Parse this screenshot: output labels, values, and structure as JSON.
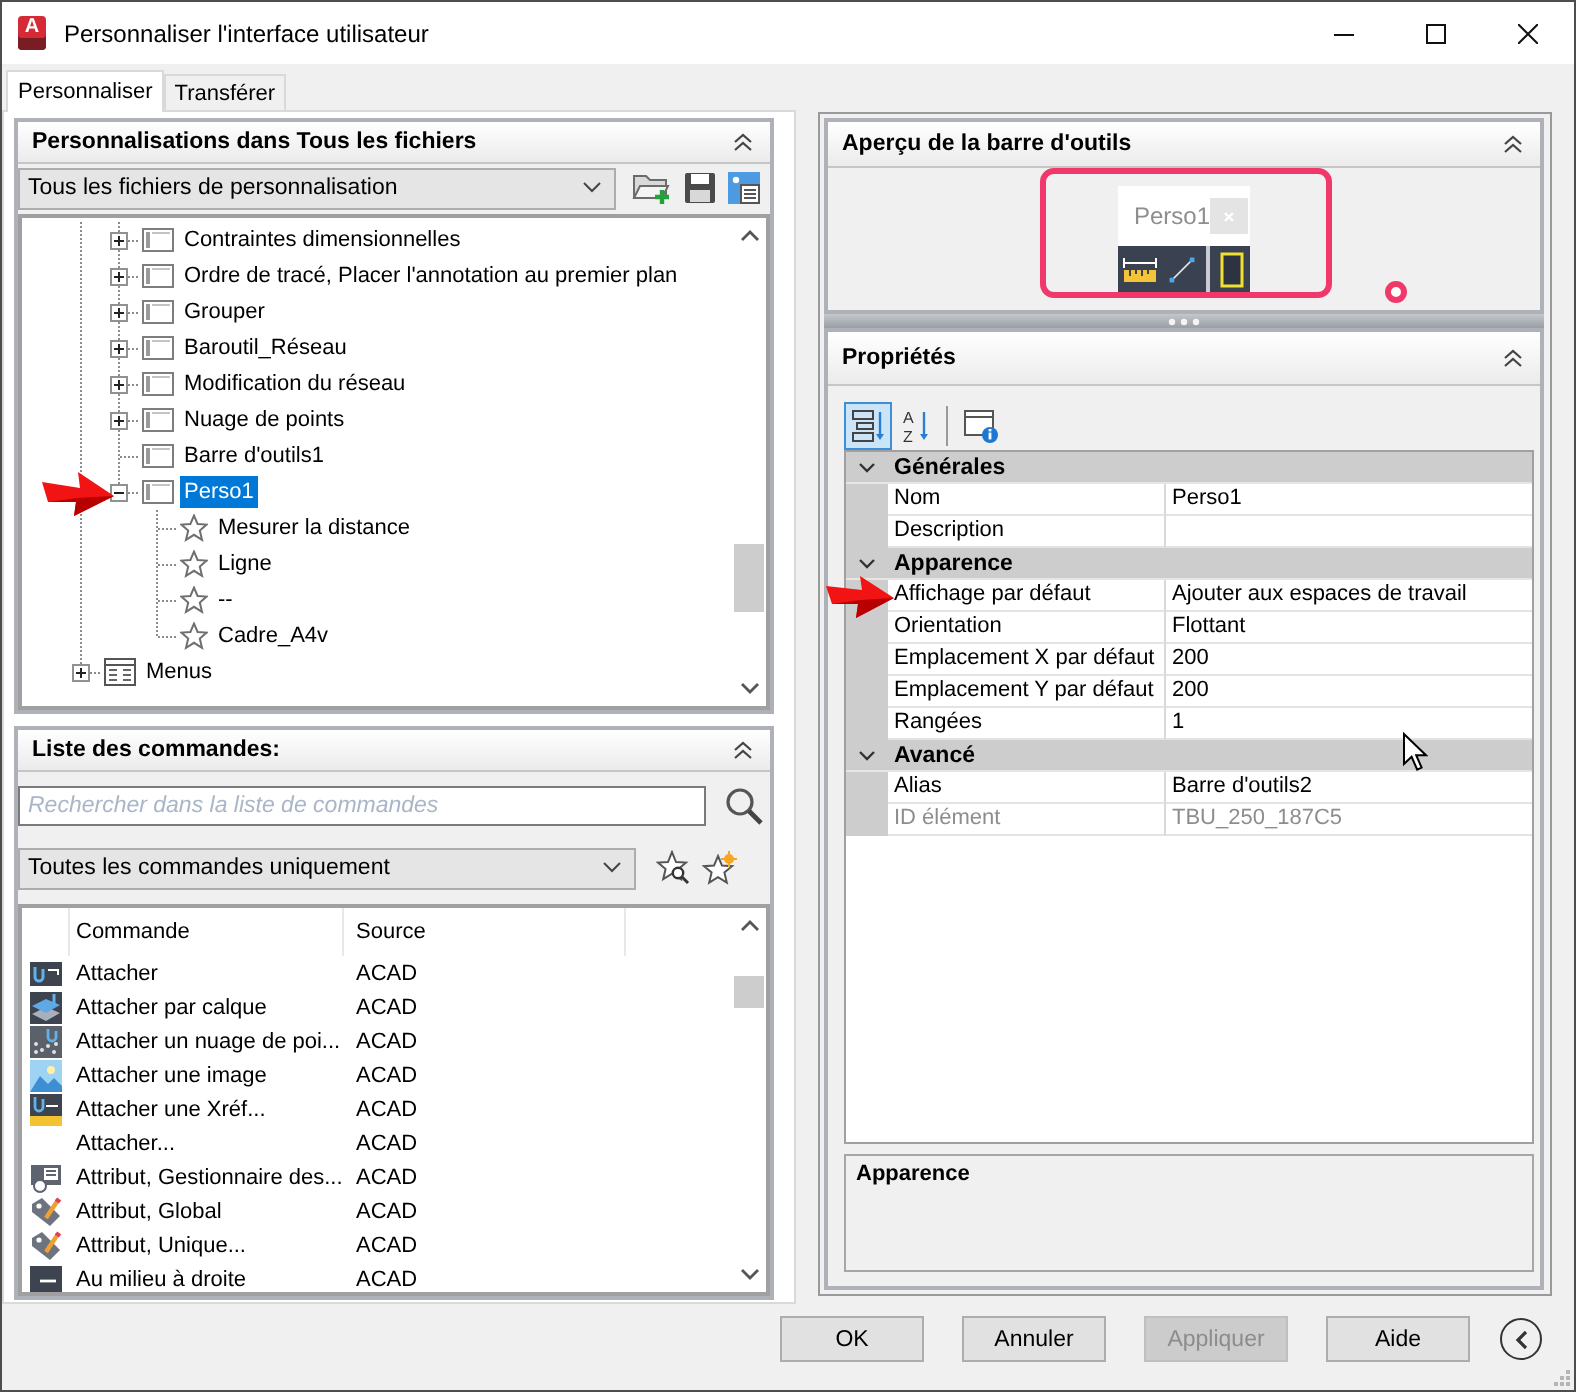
{
  "window": {
    "logo_letter": "A",
    "title": "Personnaliser l'interface utilisateur"
  },
  "tabs": [
    {
      "label": "Personnaliser",
      "selected": true
    },
    {
      "label": "Transférer",
      "selected": false
    }
  ],
  "customizations": {
    "title": "Personnalisations dans Tous les fichiers",
    "expanded": true,
    "file_filter": "Tous les fichiers de personnalisation",
    "tree": [
      {
        "children": [
          {
            "kind": "toolbar",
            "label": "Contraintes dimensionnelles",
            "expanded": false,
            "selected": false
          },
          {
            "kind": "toolbar",
            "label": "Ordre de tracé, Placer l'annotation au premier plan",
            "expanded": false,
            "selected": false
          },
          {
            "kind": "toolbar",
            "label": "Grouper",
            "expanded": false,
            "selected": false
          },
          {
            "kind": "toolbar",
            "label": "Baroutil_Réseau",
            "expanded": false,
            "selected": false
          },
          {
            "kind": "toolbar",
            "label": "Modification du réseau",
            "expanded": false,
            "selected": false
          },
          {
            "kind": "toolbar",
            "label": "Nuage de points",
            "expanded": false,
            "selected": false
          },
          {
            "kind": "toolbar",
            "label": "Barre d'outils1",
            "selected": false
          },
          {
            "kind": "toolbar",
            "label": "Perso1",
            "expanded": true,
            "selected": true,
            "children": [
              {
                "kind": "command",
                "label": "Mesurer la distance",
                "selected": false
              },
              {
                "kind": "command",
                "label": "Ligne",
                "selected": false
              },
              {
                "kind": "command",
                "label": "--",
                "selected": false
              },
              {
                "kind": "command",
                "label": "Cadre_A4v",
                "selected": false
              }
            ]
          }
        ]
      },
      {
        "kind": "menus",
        "label": "Menus",
        "expanded": false,
        "selected": false
      }
    ]
  },
  "commands": {
    "title": "Liste des commandes:",
    "expanded": true,
    "search": {
      "placeholder": "Rechercher dans la liste de commandes"
    },
    "filter": "Toutes les commandes uniquement",
    "columns": [
      "Commande",
      "Source"
    ],
    "rows": [
      {
        "kind": "attach",
        "command": "Attacher",
        "source": "ACAD"
      },
      {
        "kind": "attach_by_layer",
        "command": "Attacher par calque",
        "source": "ACAD"
      },
      {
        "kind": "attach_point_cloud",
        "command": "Attacher un nuage de poi...",
        "source": "ACAD"
      },
      {
        "kind": "attach_image",
        "command": "Attacher une image",
        "source": "ACAD"
      },
      {
        "kind": "attach_xref",
        "command": "Attacher une Xréf...",
        "source": "ACAD"
      },
      {
        "kind": "plain",
        "command": "Attacher...",
        "source": "ACAD"
      },
      {
        "kind": "attribute_manager",
        "command": "Attribut, Gestionnaire des...",
        "source": "ACAD"
      },
      {
        "kind": "attribute_edit",
        "command": "Attribut, Global",
        "source": "ACAD"
      },
      {
        "kind": "attribute_edit",
        "command": "Attribut, Unique...",
        "source": "ACAD"
      },
      {
        "kind": "align",
        "command": "Au milieu à droite",
        "source": "ACAD"
      }
    ]
  },
  "preview": {
    "title": "Aperçu de la barre d'outils",
    "expanded": true,
    "toolbar_name": "Perso1",
    "buttons": [
      {
        "kind": "measure"
      },
      {
        "kind": "line"
      },
      {
        "kind": "separator"
      },
      {
        "kind": "frame"
      }
    ]
  },
  "properties": {
    "title": "Propriétés",
    "expanded": true,
    "view_buttons": [
      {
        "kind": "categorized",
        "selected": true
      },
      {
        "kind": "alphabetical",
        "selected": false,
        "letters": [
          "A",
          "Z"
        ]
      },
      {
        "kind": "description",
        "selected": false
      }
    ],
    "categories": [
      {
        "label": "Générales",
        "expanded": true,
        "rows": [
          {
            "name": "Nom",
            "value": "Perso1",
            "disabled": false
          },
          {
            "name": "Description",
            "disabled": false
          }
        ]
      },
      {
        "label": "Apparence",
        "expanded": true,
        "rows": [
          {
            "name": "Affichage par défaut",
            "value": "Ajouter aux espaces de travail",
            "disabled": false
          },
          {
            "name": "Orientation",
            "value": "Flottant",
            "disabled": false
          },
          {
            "name": "Emplacement X par défaut",
            "value": "200",
            "disabled": false
          },
          {
            "name": "Emplacement Y par défaut",
            "value": "200",
            "disabled": false
          },
          {
            "name": "Rangées",
            "value": "1",
            "disabled": false
          }
        ]
      },
      {
        "label": "Avancé",
        "expanded": true,
        "rows": [
          {
            "name": "Alias",
            "value": "Barre d'outils2",
            "disabled": false
          },
          {
            "name": "ID élément",
            "value": "TBU_250_187C5",
            "disabled": true
          }
        ]
      }
    ],
    "help": {
      "title": "Apparence"
    }
  },
  "buttons": [
    {
      "label": "OK",
      "disabled": false
    },
    {
      "label": "Annuler",
      "disabled": false
    },
    {
      "label": "Appliquer",
      "disabled": true
    },
    {
      "label": "Aide",
      "disabled": false
    }
  ]
}
